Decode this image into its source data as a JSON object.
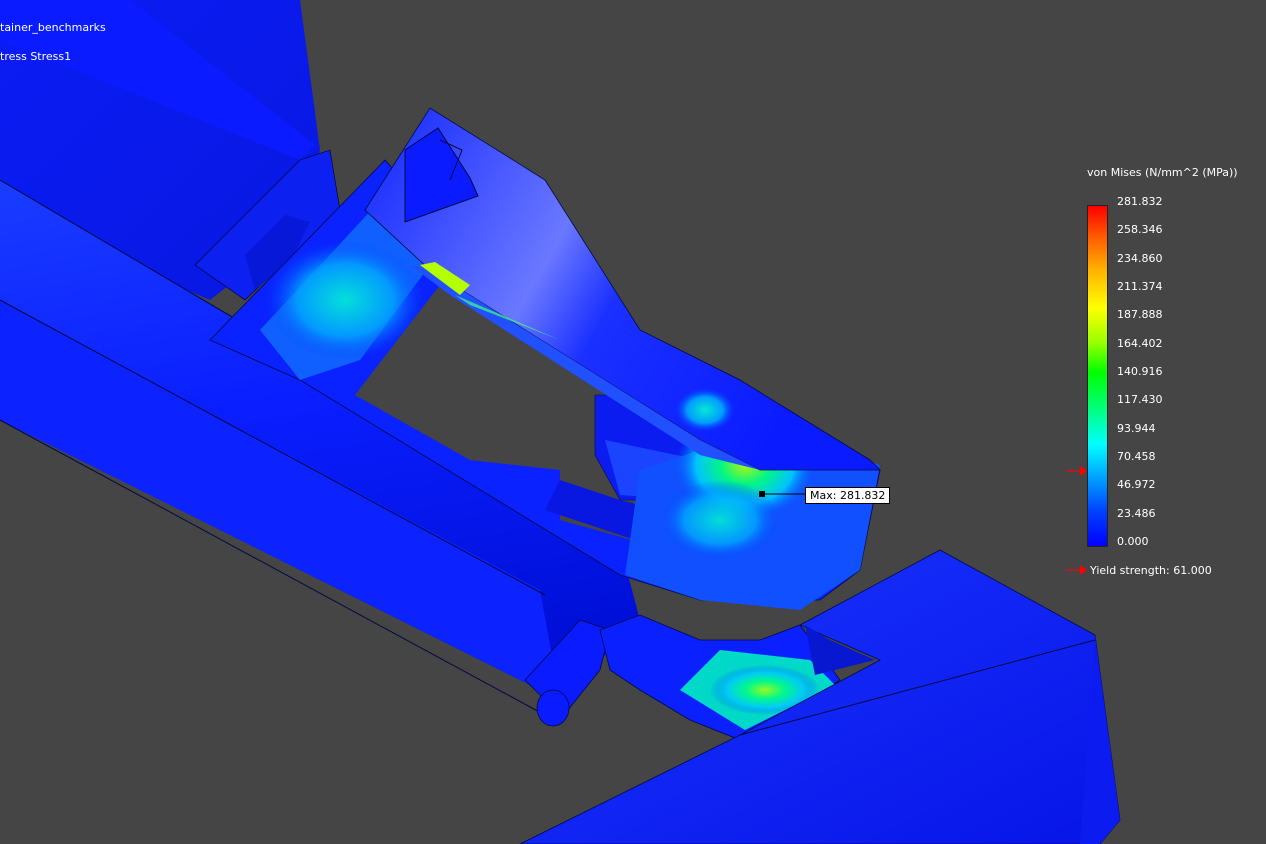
{
  "viewport": {
    "model_name": "tainer_benchmarks",
    "study_name": "tress Stress1"
  },
  "legend": {
    "title": "von Mises (N/mm^2 (MPa))",
    "ticks": [
      "281.832",
      "258.346",
      "234.860",
      "211.374",
      "187.888",
      "164.402",
      "140.916",
      "117.430",
      "93.944",
      "70.458",
      "46.972",
      "23.486",
      "0.000"
    ],
    "yield_label": "Yield strength: 61.000",
    "yield_value": 61.0,
    "max_value": 281.832,
    "min_value": 0.0
  },
  "probe": {
    "max_label": "Max: 281.832"
  },
  "colors": {
    "background": "#454545",
    "mesh_blue": "#0a1eff",
    "marker_red": "#ff0000"
  }
}
